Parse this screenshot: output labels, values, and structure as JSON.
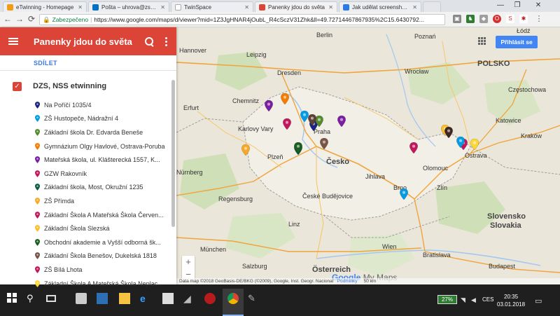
{
  "browser": {
    "tabs": [
      {
        "label": "eTwinning - Homepage",
        "color": "#f39c12"
      },
      {
        "label": "Pošta – uhrova@zsben.c",
        "color": "#0072c6"
      },
      {
        "label": "TwinSpace",
        "color": "#1a73e8"
      },
      {
        "label": "Panenky jdou do světa",
        "color": "#db4437"
      },
      {
        "label": "Jak udělat screenshot? Ja",
        "color": "#2c7be5"
      }
    ],
    "secure_label": "Zabezpečeno",
    "url": "https://www.google.com/maps/d/viewer?mid=1Z3JgHNAR4jOubL_R4cSczV31Zhk&ll=49.72714467867935%2C15.6430792..."
  },
  "panel": {
    "title": "Panenky jdou do světa",
    "share_label": "SDÍLET",
    "layer_name": "DZS, NSS etwinning",
    "places": [
      {
        "label": "Na Poříčí 1035/4",
        "color": "#1a237e"
      },
      {
        "label": "ZŠ Hustopeče, Nádražní 4",
        "color": "#039be5"
      },
      {
        "label": "Základní škola Dr. Edvarda Beneše",
        "color": "#558b2f"
      },
      {
        "label": "Gymnázium Olgy Havlové, Ostrava-Poruba",
        "color": "#f57c00"
      },
      {
        "label": "Mateřská škola, ul. Klášterecká 1557,  K...",
        "color": "#7b1fa2"
      },
      {
        "label": "GZW Rakovník",
        "color": "#c2185b"
      },
      {
        "label": "Základní škola, Most, Okružní 1235",
        "color": "#0b5e45"
      },
      {
        "label": "ZŠ Přímda",
        "color": "#f9a825"
      },
      {
        "label": "Základní Škola A Mateřská Škola Červen...",
        "color": "#c2185b"
      },
      {
        "label": "Základní Škola Slezská",
        "color": "#fbc02d"
      },
      {
        "label": "Obchodní akademie a Vyšší odborná šk...",
        "color": "#1b5e20"
      },
      {
        "label": "Základní Škola Benešov, Dukelská 1818",
        "color": "#795548"
      },
      {
        "label": "ZŠ Bílá Lhota",
        "color": "#c2185b"
      },
      {
        "label": "Základní Škola A Mateřská Škola Neplac...",
        "color": "#fdd835"
      }
    ]
  },
  "map": {
    "login_label": "Přihlásit se",
    "zoom_in": "+",
    "zoom_out": "−",
    "logo": "Google",
    "logo_suffix": "My Maps",
    "attribution": "Data map ©2018 GeoBasis-DE/BKG (©2009), Google, Inst. Geogr. Nacional",
    "terms": "Podmínky",
    "scale": "50 km",
    "labels": {
      "lodz": "Łódź",
      "hannover": "Hannover",
      "berlin": "Berlin",
      "poznan": "Poznań",
      "leipzig": "Leipzig",
      "dresden": "Dresden",
      "wroclaw": "Wrocław",
      "czestochowa": "Częstochowa",
      "polska": "POLSKO",
      "katowice": "Katowice",
      "krakow": "Kraków",
      "cesko": "Česko",
      "brno": "Brno",
      "praha": "Praha",
      "plzen": "Plzeň",
      "nurnberg": "Nürnberg",
      "regensburg": "Regensburg",
      "munchen": "München",
      "linz": "Linz",
      "wien": "Wien",
      "bratislava": "Bratislava",
      "slovensko": "Slovensko",
      "slovakia": "Slovakia",
      "osterreich": "Österreich",
      "budapest": "Budapest",
      "karlovy_vary": "Karlovy Vary",
      "ostrava": "Ostrava",
      "ceske_budejovice": "České Budějovice",
      "jihlava": "Jihlava",
      "olomouc": "Olomouc",
      "zlin": "Zlín",
      "salzburg": "Salzburg",
      "erfurt": "Erfurt",
      "chemnitz": "Chemnitz"
    }
  },
  "taskbar": {
    "battery": "27%",
    "lang": "CES",
    "time": "20:35",
    "date": "03.01.2018"
  }
}
